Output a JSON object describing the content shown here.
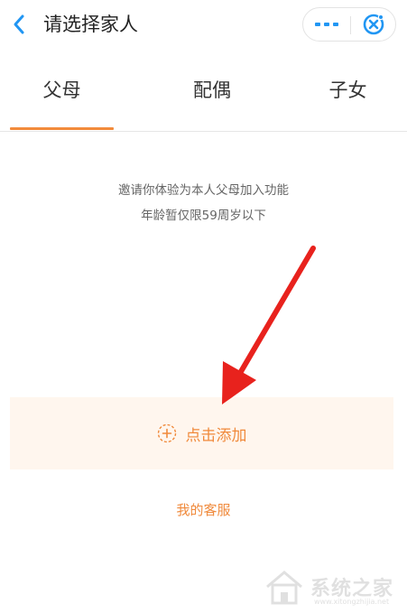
{
  "header": {
    "title": "请选择家人",
    "back_icon": "chevron-left-icon",
    "more_icon": "more-dots-icon",
    "close_icon": "close-circle-icon"
  },
  "tabs": [
    {
      "label": "父母",
      "active": true
    },
    {
      "label": "配偶",
      "active": false
    },
    {
      "label": "子女",
      "active": false
    }
  ],
  "info": {
    "line1": "邀请你体验为本人父母加入功能",
    "line2": "年龄暂仅限59周岁以下"
  },
  "add": {
    "label": "点击添加",
    "icon": "plus-circle-icon"
  },
  "service": {
    "label": "我的客服"
  },
  "watermark": {
    "text": "系统之家",
    "url": "www.xitongzhijia.net"
  },
  "colors": {
    "accent": "#f28b3b",
    "header_icon_blue": "#2196f3",
    "add_bg": "#fff6ee",
    "arrow_red": "#e8221d"
  }
}
